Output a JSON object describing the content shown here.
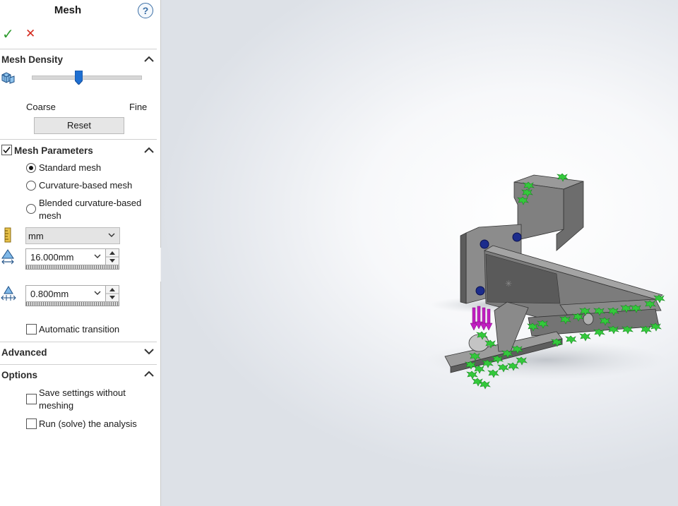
{
  "panel": {
    "title": "Mesh",
    "help_glyph": "?",
    "ok_glyph": "✓",
    "cancel_glyph": "✕"
  },
  "mesh_density": {
    "header": "Mesh Density",
    "slider_level": 0.43,
    "coarse_label": "Coarse",
    "fine_label": "Fine",
    "reset_label": "Reset"
  },
  "mesh_parameters": {
    "header": "Mesh Parameters",
    "enabled": true,
    "options": [
      {
        "label": "Standard mesh",
        "selected": true
      },
      {
        "label": "Curvature-based mesh",
        "selected": false
      },
      {
        "label": "Blended curvature-based mesh",
        "selected": false
      }
    ],
    "blended_line1": "Blended curvature-based",
    "blended_line2": "mesh",
    "unit_value": "mm",
    "element_size": "16.000mm",
    "tolerance": "0.800mm",
    "automatic_transition_label": "Automatic transition"
  },
  "advanced": {
    "header": "Advanced"
  },
  "options": {
    "header": "Options",
    "save_line1": "Save settings without",
    "save_line2": "meshing",
    "run_label": "Run (solve) the analysis"
  },
  "icons": {
    "ok": "check-icon",
    "cancel": "close-icon",
    "help": "help-icon",
    "density": "mesh-density-icon",
    "unit": "ruler-icon",
    "size": "element-size-icon",
    "tolerance": "tolerance-icon"
  },
  "colors": {
    "ok": "#2e9b2e",
    "cancel": "#d42a1e",
    "slider_thumb": "#1f6fd1",
    "fixture_green": "#2ecc40",
    "load_magenta": "#c21fc2",
    "part_gray": "#7a7a7a"
  }
}
